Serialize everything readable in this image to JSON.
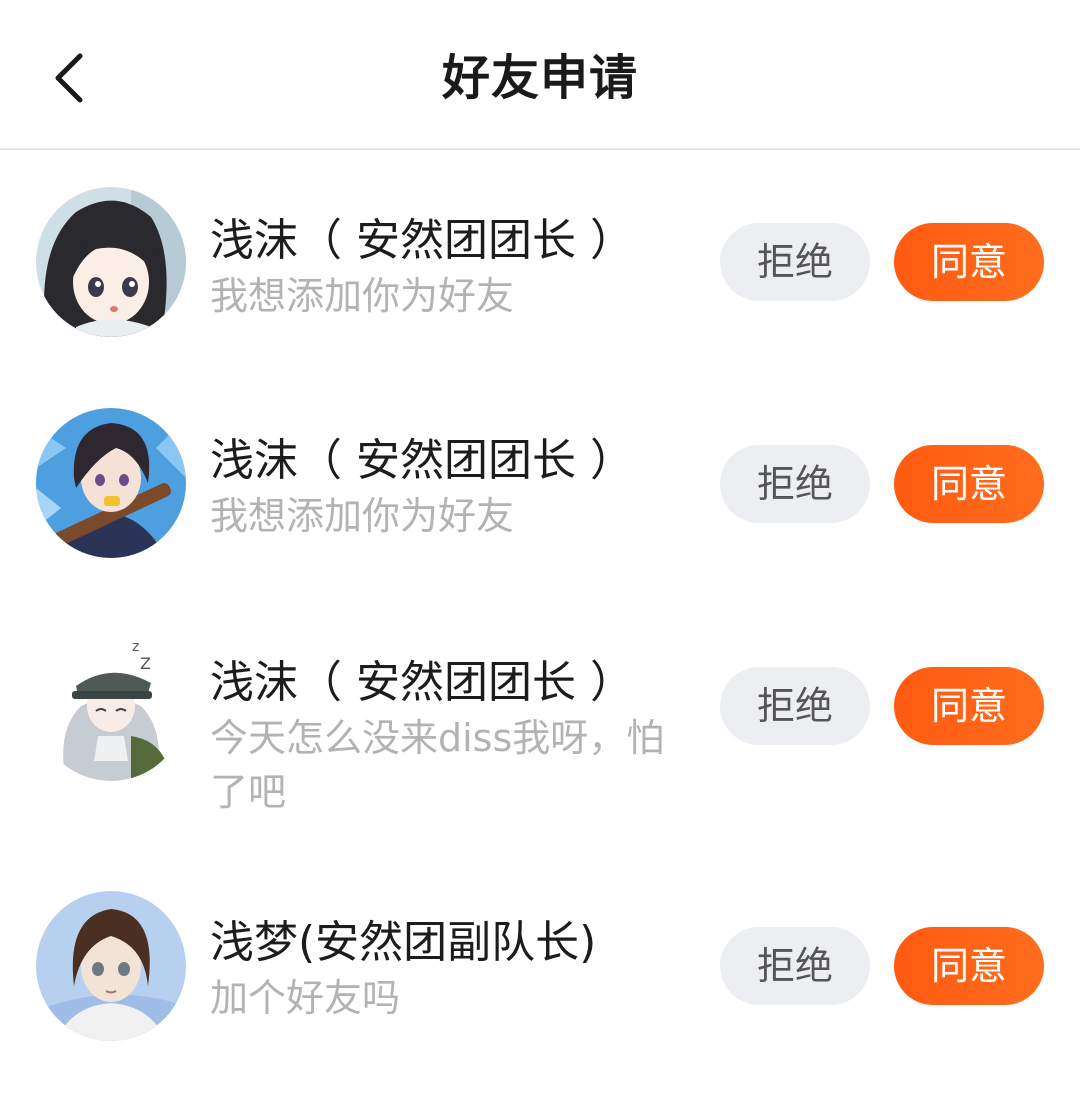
{
  "header": {
    "title": "好友申请"
  },
  "labels": {
    "reject": "拒绝",
    "accept": "同意"
  },
  "requests": [
    {
      "name": "浅沫（ 安然团团长 ）",
      "message": "我想添加你为好友",
      "avatar": "avatar-girl-black-hair"
    },
    {
      "name": "浅沫（ 安然团团长 ）",
      "message": "我想添加你为好友",
      "avatar": "avatar-boy-blue-background"
    },
    {
      "name": "浅沫（ 安然团团长 ）",
      "message": "今天怎么没来diss我呀，怕了吧",
      "avatar": "avatar-girl-military-cap"
    },
    {
      "name": "浅梦(安然团副队长)",
      "message": "加个好友吗",
      "avatar": "avatar-girl-brown-hair"
    }
  ],
  "colors": {
    "accept_bg": "#ff5a12",
    "reject_bg": "#eceef1",
    "message_text": "#b3b3b3"
  }
}
